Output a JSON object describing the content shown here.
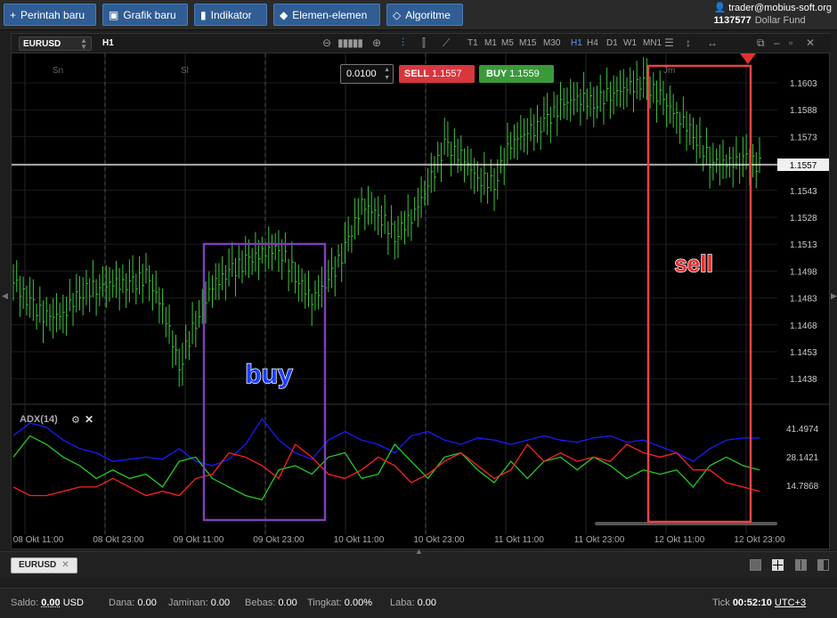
{
  "toolbar": {
    "new_order": "Perintah baru",
    "new_chart": "Grafik baru",
    "indicator": "Indikator",
    "elements": "Elemen-elemen",
    "algorithm": "Algoritme"
  },
  "account": {
    "email": "trader@mobius-soft.org",
    "id": "1137577",
    "fund": "Dollar Fund"
  },
  "chart": {
    "symbol": "EURUSD",
    "period": "H1",
    "lot": "0.0100",
    "sell_label": "SELL",
    "sell_price": "1.1557",
    "buy_label": "BUY",
    "buy_price": "1.1559",
    "timeframes": [
      "T1",
      "M1",
      "M5",
      "M15",
      "M30",
      "H1",
      "H4",
      "D1",
      "W1",
      "MN1"
    ],
    "active_tf": "H1",
    "day_labels": [
      "Sn",
      "Sl",
      "Jm"
    ],
    "price_ticks": [
      "1.1603",
      "1.1588",
      "1.1573",
      "1.1557",
      "1.1543",
      "1.1528",
      "1.1513",
      "1.1498",
      "1.1483",
      "1.1468",
      "1.1453",
      "1.1438"
    ],
    "current_price": "1.1557",
    "indicator_name": "ADX(14)",
    "adx_ticks": [
      "41.4974",
      "28.1421",
      "14.7868"
    ],
    "time_labels": [
      "08 Okt 11:00",
      "08 Okt 23:00",
      "09 Okt 11:00",
      "09 Okt 23:00",
      "10 Okt 11:00",
      "10 Okt 23:00",
      "11 Okt 11:00",
      "11 Okt 23:00",
      "12 Okt 11:00",
      "12 Okt 23:00"
    ],
    "annot_buy": "buy",
    "annot_sell": "sell"
  },
  "chart_data": {
    "type": "line",
    "series": [
      {
        "values": [
          1.1492,
          1.148,
          1.1472,
          1.1474,
          1.1486,
          1.1489,
          1.1491,
          1.149,
          1.1495,
          1.1478,
          1.1445,
          1.147,
          1.149,
          1.1497,
          1.1503,
          1.1508,
          1.1511,
          1.1496,
          1.1482,
          1.1492,
          1.151,
          1.1535,
          1.153,
          1.1518,
          1.1528,
          1.1545,
          1.1568,
          1.1562,
          1.155,
          1.1547,
          1.157,
          1.1575,
          1.158,
          1.159,
          1.1595,
          1.1592,
          1.1597,
          1.16,
          1.1603,
          1.1595,
          1.1585,
          1.1575,
          1.156,
          1.1558,
          1.156,
          1.1557
        ]
      },
      {
        "values": [
          38,
          44,
          42,
          36,
          32,
          30,
          26,
          27,
          28,
          27,
          32,
          26,
          24,
          27,
          34,
          46,
          36,
          30,
          27,
          36,
          40,
          36,
          34,
          30,
          38,
          40,
          36,
          34,
          37,
          36,
          34,
          36,
          38,
          36,
          35,
          37,
          38,
          35,
          36,
          33,
          30,
          26,
          32,
          36,
          37,
          37
        ]
      },
      {
        "values": [
          28,
          38,
          34,
          28,
          24,
          18,
          22,
          18,
          20,
          14,
          26,
          28,
          18,
          14,
          10,
          8,
          22,
          24,
          20,
          28,
          30,
          18,
          20,
          34,
          26,
          18,
          28,
          30,
          22,
          16,
          26,
          18,
          26,
          28,
          22,
          28,
          24,
          18,
          22,
          20,
          22,
          14,
          24,
          28,
          24,
          22
        ]
      },
      {
        "values": [
          14,
          10,
          10,
          12,
          14,
          14,
          18,
          14,
          10,
          12,
          10,
          18,
          20,
          30,
          28,
          24,
          18,
          34,
          28,
          20,
          18,
          22,
          28,
          24,
          16,
          20,
          26,
          30,
          24,
          18,
          22,
          34,
          26,
          30,
          26,
          28,
          26,
          34,
          30,
          28,
          30,
          22,
          22,
          16,
          14,
          12
        ]
      }
    ]
  }
}
